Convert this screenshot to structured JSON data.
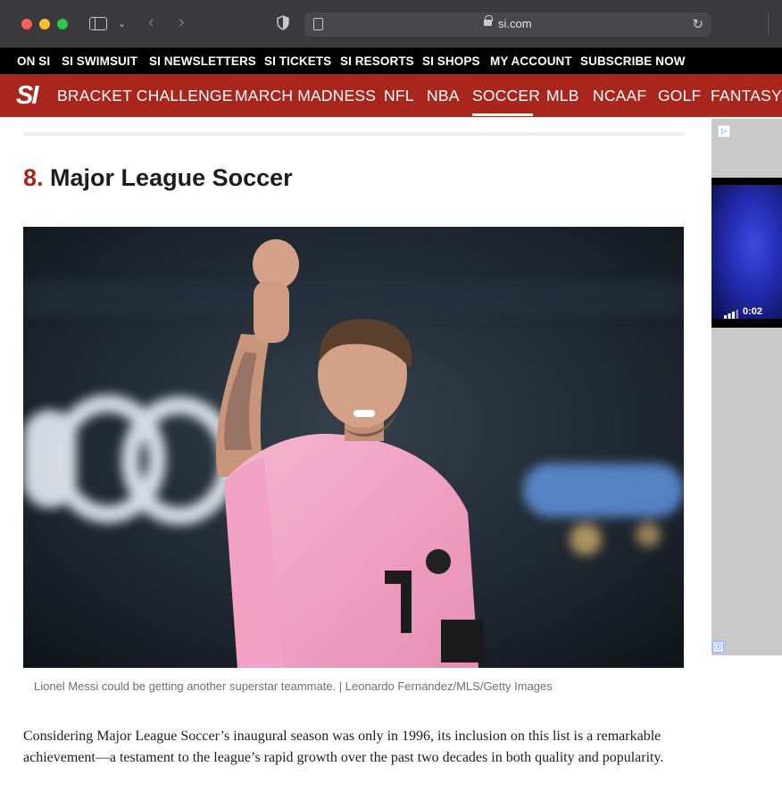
{
  "browser": {
    "url": "si.com",
    "icons": [
      "sidebar-toggle-icon",
      "chevron-down-icon",
      "back-arrow-icon",
      "forward-arrow-icon",
      "shield-icon",
      "reader-icon",
      "lock-icon",
      "reload-icon"
    ],
    "glyphs": {
      "chevron": "⌄",
      "back": "‹",
      "forward": "›",
      "reload": "↻"
    }
  },
  "topbar": {
    "items": [
      "ON SI",
      "SI SWIMSUIT",
      "SI NEWSLETTERS",
      "SI TICKETS",
      "SI RESORTS",
      "SI SHOPS",
      "MY ACCOUNT",
      "SUBSCRIBE NOW"
    ]
  },
  "nav": {
    "logo": "SI",
    "items": [
      "BRACKET CHALLENGE",
      "MARCH MADNESS",
      "NFL",
      "NBA",
      "SOCCER",
      "MLB",
      "NCAAF",
      "GOLF",
      "FANTASY"
    ],
    "active": "SOCCER"
  },
  "article": {
    "heading_number": "8.",
    "heading_text": "Major League Soccer",
    "caption": "Lionel Messi could be getting another superstar teammate. | Leonardo Fernandez/MLS/Getty Images",
    "paragraph": "Considering Major League Soccer’s inaugural season was only in 1996, its inclusion on this list is a remarkable achievement—a testament to the league’s rapid growth over the past two decades in both quality and popularity."
  },
  "ad": {
    "badge": "▷",
    "video_time": "0:02",
    "info": "ⓘ"
  },
  "colors": {
    "brand_red": "#a8261b",
    "topbar_black": "#000000",
    "jersey_pink": "#f2a3c4"
  }
}
